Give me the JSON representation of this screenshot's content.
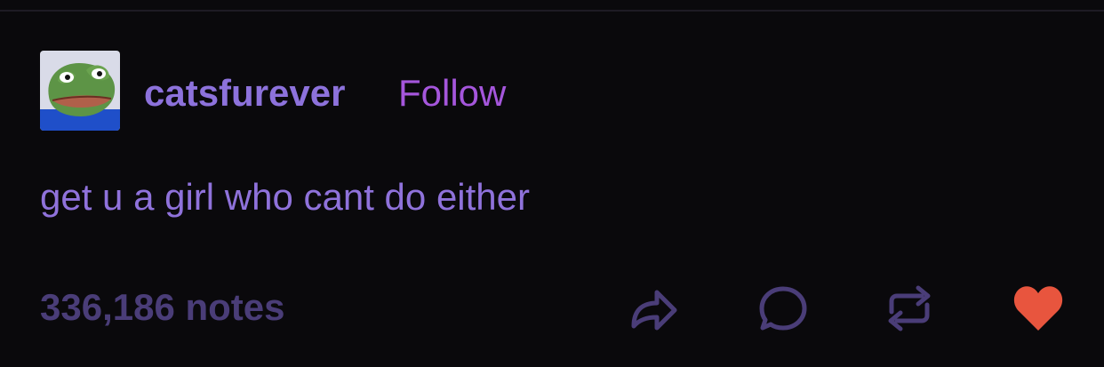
{
  "post": {
    "username": "catsfurever",
    "follow_label": "Follow",
    "body_text": "get u a girl who cant do either",
    "notes_label": "336,186 notes"
  },
  "avatar": {
    "icon": "frog-avatar-icon"
  },
  "actions": {
    "share_icon": "share-icon",
    "reply_icon": "reply-icon",
    "reblog_icon": "reblog-icon",
    "like_icon": "heart-icon",
    "like_color": "#e8553e"
  },
  "colors": {
    "background": "#0a090c",
    "username": "#8d72dc",
    "follow": "#a556dc",
    "text": "#8f72db",
    "muted": "#4a3d78"
  }
}
